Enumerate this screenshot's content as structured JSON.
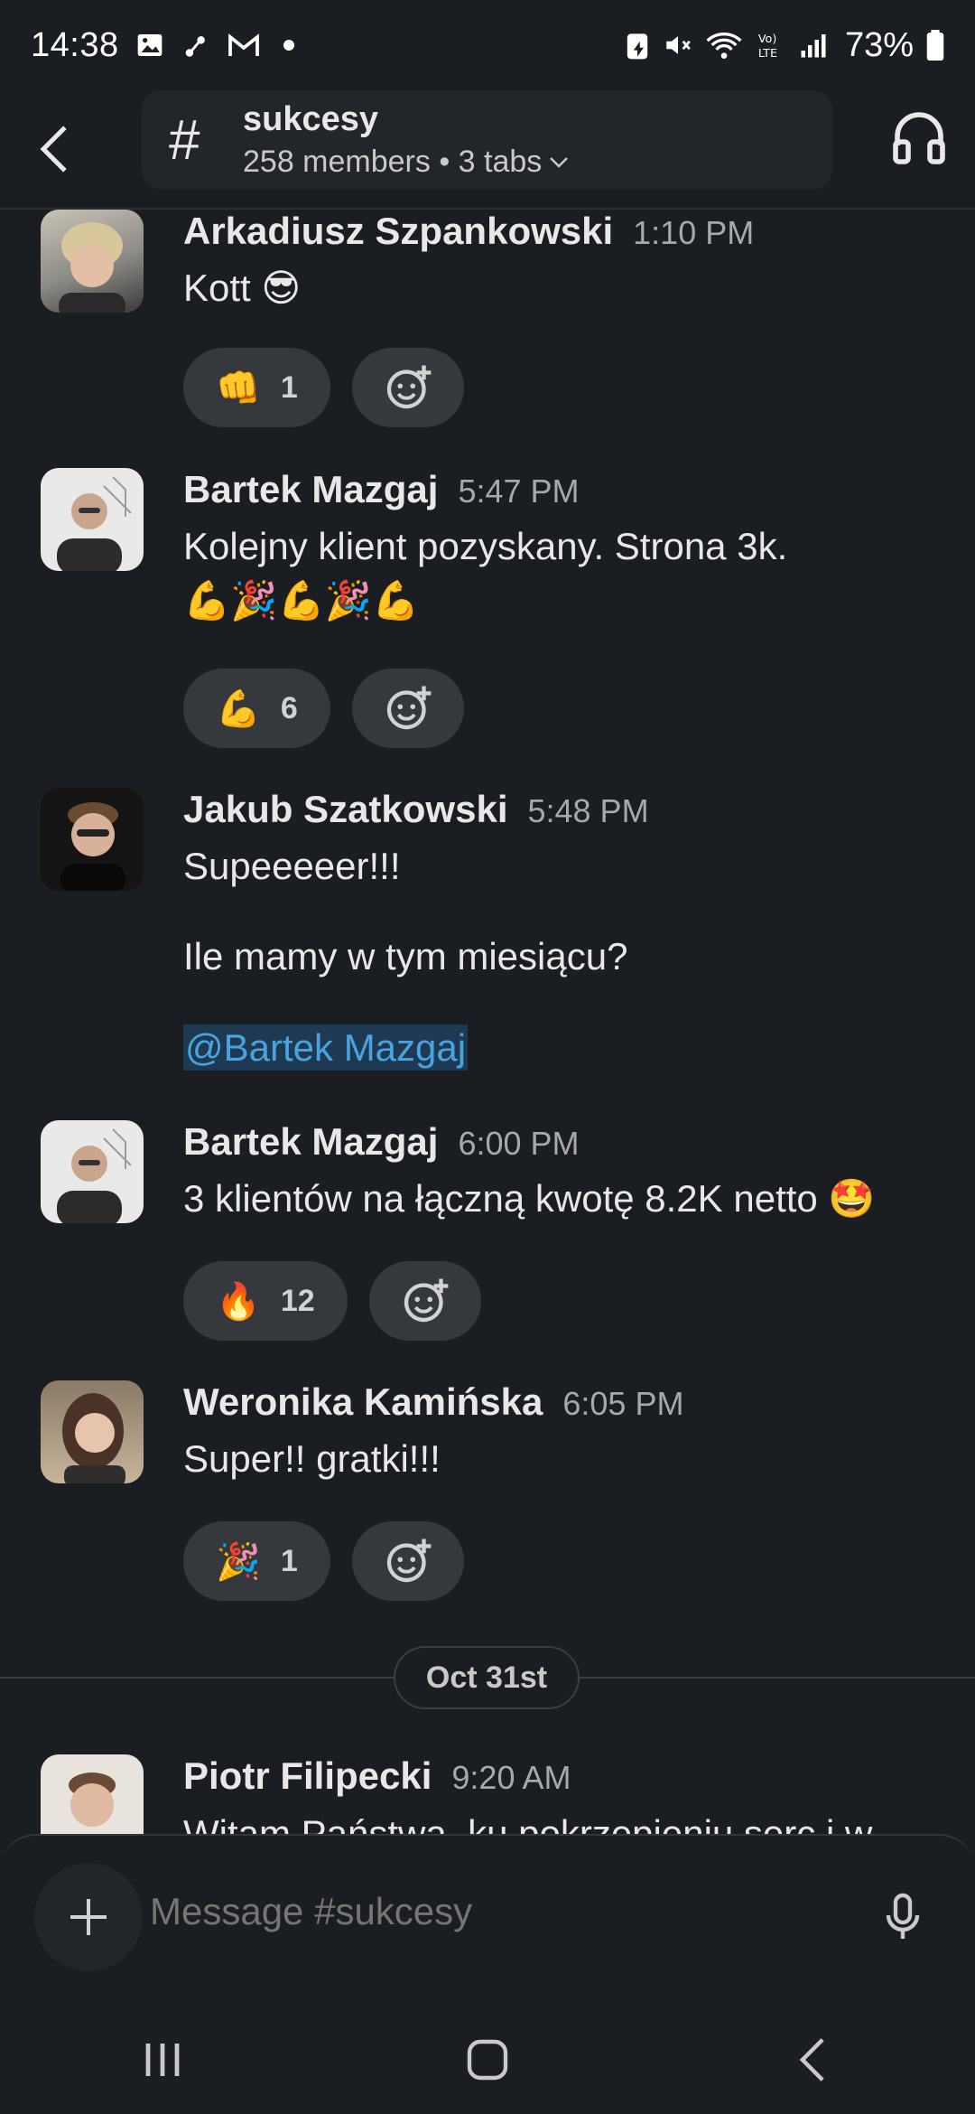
{
  "status_bar": {
    "time": "14:38",
    "battery": "73%"
  },
  "header": {
    "channel_name": "sukcesy",
    "channel_meta": "258 members • 3 tabs"
  },
  "messages": [
    {
      "author": "Arkadiusz Szpankowski",
      "time": "1:10 PM",
      "text": "Kott 😎",
      "reactions": [
        {
          "emoji": "👊",
          "count": "1"
        }
      ]
    },
    {
      "author": "Bartek Mazgaj",
      "time": "5:47 PM",
      "text": "Kolejny klient pozyskany. Strona 3k.",
      "emoji_line": "💪🎉💪🎉💪",
      "reactions": [
        {
          "emoji": "💪",
          "count": "6"
        }
      ]
    },
    {
      "author": "Jakub Szatkowski",
      "time": "5:48 PM",
      "text": "Supeeeeer!!!",
      "text2": "Ile mamy w tym miesiącu?",
      "mention": "@Bartek Mazgaj"
    },
    {
      "author": "Bartek Mazgaj",
      "time": "6:00 PM",
      "text": "3 klientów na łączną kwotę 8.2K netto 🤩",
      "reactions": [
        {
          "emoji": "🔥",
          "count": "12"
        }
      ]
    },
    {
      "author": "Weronika Kamińska",
      "time": "6:05 PM",
      "text": "Super!! gratki!!!",
      "reactions": [
        {
          "emoji": "🎉",
          "count": "1"
        }
      ]
    },
    {
      "author": "Piotr Filipecki",
      "time": "9:20 AM",
      "text": "Witam Państwa, ku pokrzepieniu serc i w"
    }
  ],
  "date_divider": "Oct 31st",
  "composer": {
    "placeholder": "Message #sukcesy"
  }
}
